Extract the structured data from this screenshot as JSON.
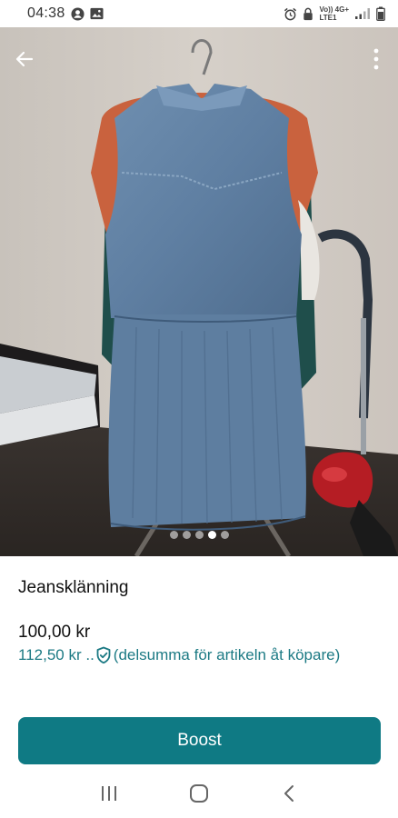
{
  "status_bar": {
    "time": "04:38",
    "network_label_top": "Vo)) 4G+",
    "network_label_bottom": "LTE1"
  },
  "gallery": {
    "image_count": 5,
    "active_index": 3
  },
  "listing": {
    "title": "Jeansklänning",
    "price": "100,00 kr",
    "buyer_price": "112,50 kr ..",
    "buyer_note": "(delsumma för artikeln åt köpare)"
  },
  "actions": {
    "boost_label": "Boost"
  },
  "colors": {
    "accent": "#0f7a84",
    "accent_text": "#1c7a84"
  },
  "icons": {
    "back": "arrow-left-icon",
    "more": "more-vertical-icon",
    "buyer_protection": "shield-check-icon",
    "nav_recents": "recent-apps-icon",
    "nav_home": "home-icon",
    "nav_back": "nav-back-icon"
  }
}
